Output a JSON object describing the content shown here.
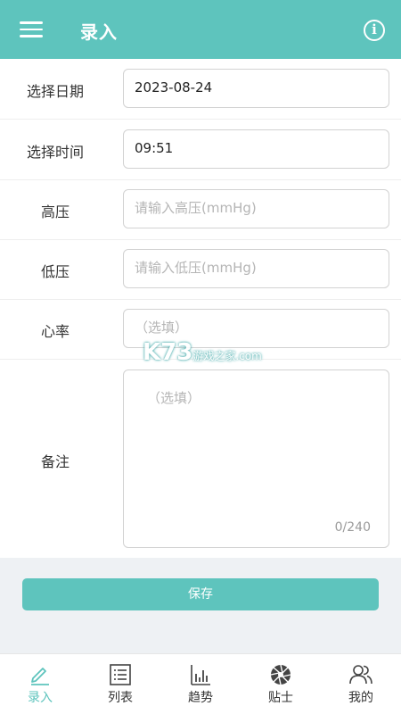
{
  "header": {
    "title": "录入",
    "menu_icon": "menu-icon",
    "info_icon": "info-icon",
    "bg_color": "#5ec4bd"
  },
  "form": {
    "date": {
      "label": "选择日期",
      "value": "2023-08-24"
    },
    "time": {
      "label": "选择时间",
      "value": "09:51"
    },
    "systolic": {
      "label": "高压",
      "placeholder": "请输入高压(mmHg)"
    },
    "diastolic": {
      "label": "低压",
      "placeholder": "请输入低压(mmHg)"
    },
    "heart_rate": {
      "label": "心率",
      "placeholder": "（选填）"
    },
    "note": {
      "label": "备注",
      "placeholder": "（选填）",
      "counter": "0/240"
    }
  },
  "save_label": "保存",
  "watermark": {
    "main": "K73",
    "sub": "游戏之家",
    "domain": ".com"
  },
  "tabs": [
    {
      "label": "录入",
      "icon": "pen-icon",
      "active": true
    },
    {
      "label": "列表",
      "icon": "list-icon",
      "active": false
    },
    {
      "label": "趋势",
      "icon": "bar-chart-icon",
      "active": false
    },
    {
      "label": "贴士",
      "icon": "aperture-icon",
      "active": false
    },
    {
      "label": "我的",
      "icon": "users-icon",
      "active": false
    }
  ]
}
